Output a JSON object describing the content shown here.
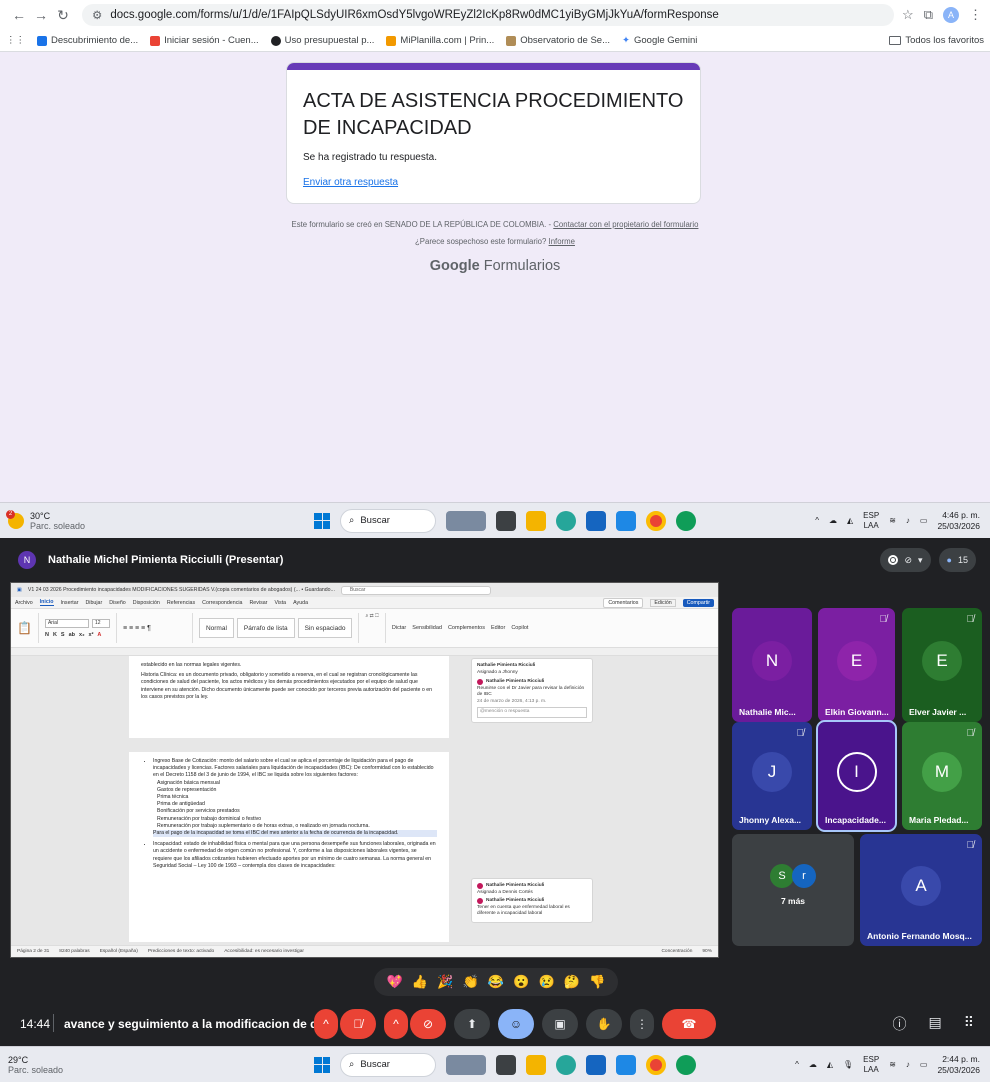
{
  "browser": {
    "url": "docs.google.com/forms/u/1/d/e/1FAIpQLSdyUIR6xmOsdY5lvgoWREyZl2IcKp8Rw0dMC1yiByGMjJkYuA/formResponse",
    "profile_initial": "A",
    "bookmarks": [
      {
        "label": "Descubrimiento de...",
        "color": "#1a73e8"
      },
      {
        "label": "Iniciar sesión - Cuen...",
        "color": "#ea4335"
      },
      {
        "label": "Uso presupuestal p...",
        "color": "#202124"
      },
      {
        "label": "MiPlanilla.com | Prin...",
        "color": "#f29900"
      },
      {
        "label": "Observatorio de Se...",
        "color": "#b08d57"
      },
      {
        "label": "Google Gemini",
        "color": "#4285f4"
      }
    ],
    "all_bookmarks": "Todos los favoritos"
  },
  "form": {
    "title": "ACTA DE ASISTENCIA PROCEDIMIENTO DE INCAPACIDAD",
    "message": "Se ha registrado tu respuesta.",
    "link": "Enviar otra respuesta",
    "footer_text": "Este formulario se creó en SENADO DE LA REPÚBLICA DE COLOMBIA. -",
    "footer_link": "Contactar con el propietario del formulario",
    "suspicious": "¿Parece sospechoso este formulario?",
    "report": "Informe",
    "brand_google": "Google",
    "brand_forms": "Formularios",
    "accent": "#673ab7"
  },
  "taskbar_top": {
    "temp": "30°C",
    "weather": "Parc. soleado",
    "badge": "2",
    "search": "Buscar",
    "lang1": "ESP",
    "lang2": "LAA",
    "time": "4:46 p. m.",
    "date": "25/03/2026"
  },
  "meet": {
    "presenter_initial": "N",
    "presenter": "Nathalie Michel Pimienta Ricciulli (Presentar)",
    "participant_count": "15",
    "time": "14:44",
    "meeting_title": "avance y seguimiento a la modificacion de d...",
    "participants": [
      {
        "initial": "N",
        "name": "Nathalie Mic...",
        "color": "#7b1fa2",
        "bg": "#6a1b9a"
      },
      {
        "initial": "E",
        "name": "Elkin Giovann...",
        "color": "#8e24aa",
        "bg": "#7b1fa2"
      },
      {
        "initial": "E",
        "name": "Elver Javier ...",
        "color": "#2e7d32",
        "bg": "#1b5e20"
      },
      {
        "initial": "J",
        "name": "Jhonny Alexa...",
        "color": "#3949ab",
        "bg": "#283593"
      },
      {
        "initial": "I",
        "name": "Incapacidade...",
        "color": "#4a148c",
        "bg": "#4a148c"
      },
      {
        "initial": "M",
        "name": "Maria Pledad...",
        "color": "#43a047",
        "bg": "#2e7d32"
      },
      {
        "initial": "A",
        "name": "Antonio Fernando Mosq...",
        "color": "#3949ab",
        "bg": "#283593"
      }
    ],
    "more": {
      "label": "7 más",
      "i1": "S",
      "i2": "r"
    },
    "reactions": [
      "💖",
      "👍",
      "🎉",
      "👏",
      "😂",
      "😮",
      "😢",
      "🤔",
      "👎"
    ]
  },
  "word": {
    "doc_title": "V1 24 03 2026 Procedimiento incapacidades MODIFICACIONES SUGERIDAS V.(copia comentarios de abogados)  (... • Guardando...",
    "search": "Buscar",
    "menu": [
      "Archivo",
      "Inicio",
      "Insertar",
      "Dibujar",
      "Diseño",
      "Disposición",
      "Referencias",
      "Correspondencia",
      "Revisar",
      "Vista",
      "Ayuda"
    ],
    "comments_btn": "Comentarios",
    "edit_btn": "Edición",
    "share_btn": "Compartir",
    "font": "Arial",
    "size": "12",
    "styles": [
      "Normal",
      "Párrafo de lista",
      "Sin espaciado"
    ],
    "ribbon_right": [
      "Dictar",
      "Sensibilidad",
      "Complementos",
      "Editor",
      "Copilot"
    ],
    "page1": [
      "establecido en las normas legales vigentes.",
      "Historia Clínica: es un documento privado, obligatorio y sometido a reserva, en el cual se registran cronológicamente las condiciones de salud del paciente, los actos médicos y los demás procedimientos ejecutados por el equipo de salud que interviene en su atención. Dicho documento únicamente puede ser conocido por terceros previa autorización del paciente o en los casos previstos por la ley."
    ],
    "page2_intro": "Ingreso Base de Cotización: monto del salario sobre el cual se aplica el porcentaje de liquidación para el pago de incapacidades y licencias. Factores salariales para liquidación de incapacidades (IBC): De conformidad con lo establecido en el Decreto 1158 del 3 de junio de 1994, el IBC se liquida sobre los siguientes factores:",
    "page2_items": [
      "Asignación básica mensual",
      "Gastos de representación",
      "Prima técnica",
      "Prima de antigüedad",
      "Bonificación por servicios prestados",
      "Remuneración por trabajo dominical o festivo",
      "Remuneración por trabajo suplementario o de horas extras, o realizado en jornada nocturna."
    ],
    "page2_tail": "Para el pago de la incapacidad se toma el IBC del mes anterior a la fecha de ocurrencia de la incapacidad.",
    "page2_b2": "Incapacidad: estado de inhabilidad física o mental para que una persona desempeñe sus funciones laborales, originada en un accidente o enfermedad de origen común no profesional. Y, conforme a las disposiciones laborales vigentes, se requiere que los afiliados cotizantes hubieren efectuado aportes por un mínimo de cuatro semanas. La norma general en Seguridad Social – Ley 100 de 1993 – contempla dos clases de incapacidades:",
    "comment1": {
      "header": "Nathalie Pimienta Ricciuli",
      "sub": "Asignado a Jhonny",
      "name": "Nathalie Pimienta Ricciuli",
      "text": "Reunirse con el Dr Javier para revisar la definición de IBC",
      "date": "24 de marzo de 2026, 4:13 p. m.",
      "reply": "@mención o respuesta"
    },
    "comment2": {
      "name": "Nathalie Pimienta Ricciuli",
      "sub": "Asignado a Dennis Cortés",
      "name2": "Nathalie Pimienta Ricciuli",
      "text": "Tener en cuenta que enfermedad laboral es diferente a incapacidad laboral"
    },
    "status": [
      "Página 2 de 31",
      "8240 palabras",
      "Español (España)",
      "Predicciones de texto: activado",
      "Accesibilidad: es necesario investigar",
      "Concentración",
      "90%"
    ]
  },
  "taskbar_bottom": {
    "temp": "29°C",
    "weather": "Parc. soleado",
    "search": "Buscar",
    "lang1": "ESP",
    "lang2": "LAA",
    "time": "2:44 p. m.",
    "date": "25/03/2026"
  }
}
